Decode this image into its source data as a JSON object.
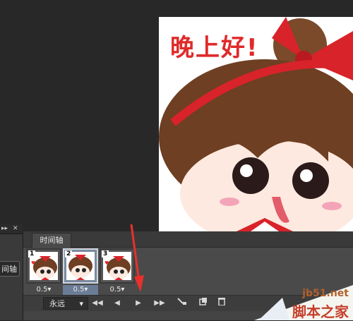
{
  "canvas": {
    "greeting": "晚上好!"
  },
  "left_panel": {
    "timeline_button": "间轴"
  },
  "timeline": {
    "tab_label": "时间轴",
    "frames": [
      {
        "number": "1",
        "delay": "0.5▾",
        "selected": false
      },
      {
        "number": "2",
        "delay": "0.5▾",
        "selected": true
      },
      {
        "number": "3",
        "delay": "0.5▾",
        "selected": false
      }
    ],
    "loop_label": "永远",
    "loop_arrow": "▾",
    "controls": [
      "◀◀",
      "◀",
      "▶",
      "▶▶"
    ]
  },
  "watermark": {
    "url": "jb51.net",
    "site_name": "脚本之家"
  },
  "colors": {
    "accent_red": "#e02a2a",
    "annotation_arrow": "#e8312b",
    "selected_frame": "#6b7d96"
  }
}
